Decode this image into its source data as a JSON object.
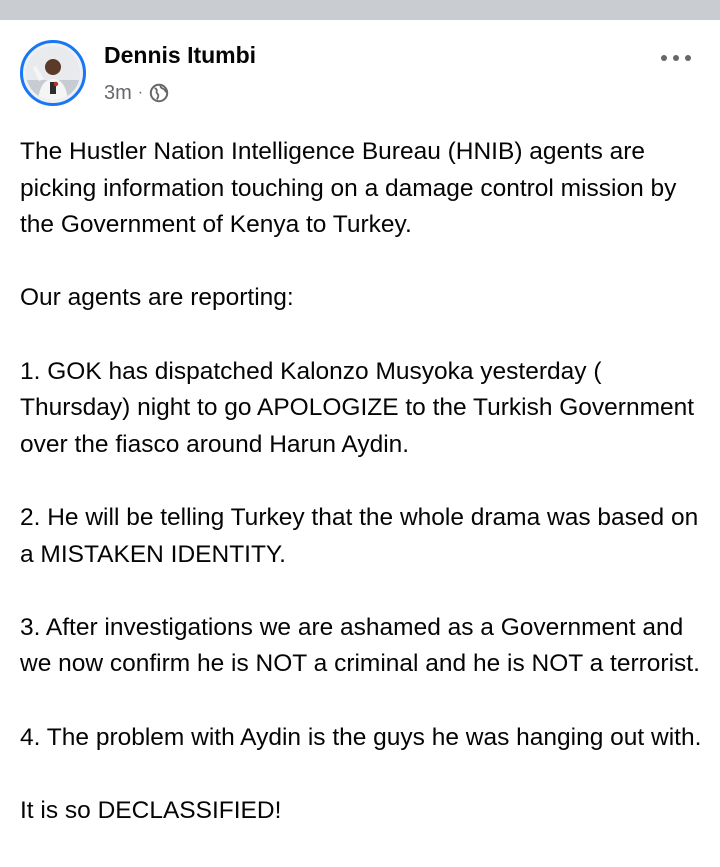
{
  "post": {
    "author_name": "Dennis Itumbi",
    "timestamp": "3m",
    "separator": "·",
    "privacy_icon": "globe-icon",
    "more_icon": "more-options-icon",
    "paragraphs": [
      "The Hustler Nation Intelligence Bureau (HNIB) agents are picking information touching on a damage control mission by the Government of Kenya to Turkey.",
      "Our agents are reporting:",
      "1. GOK has dispatched Kalonzo Musyoka yesterday ( Thursday) night to go APOLOGIZE to the Turkish Government over the fiasco around Harun Aydin.",
      "2. He will be telling Turkey that the whole drama was based on a MISTAKEN IDENTITY.",
      "3. After investigations we are ashamed as a Government and we now confirm he is NOT a criminal and he is NOT a terrorist.",
      "4. The problem with Aydin is the guys he was hanging out with.",
      "It is so DECLASSIFIED!"
    ]
  },
  "colors": {
    "accent": "#1877f2",
    "text": "#050505",
    "secondary_text": "#65676b",
    "top_strip": "#c9ccd1"
  }
}
